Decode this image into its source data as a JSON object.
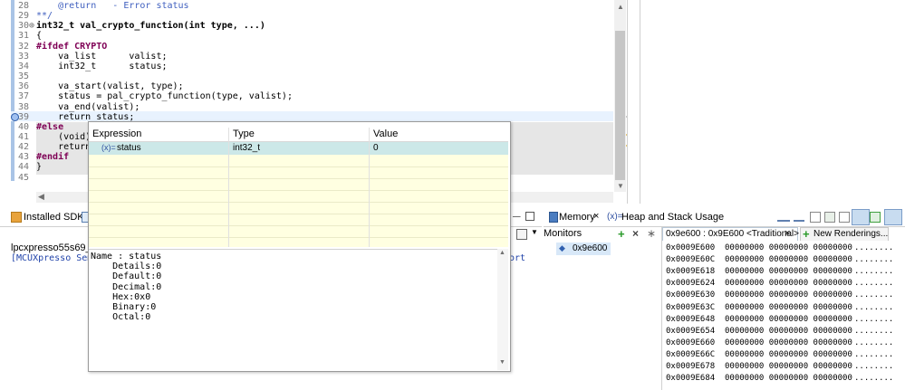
{
  "editor": {
    "lines": [
      {
        "n": "28",
        "text": "    @return   - Error status",
        "cls": "cm"
      },
      {
        "n": "29",
        "text": "**/",
        "cls": "cm"
      },
      {
        "n": "30⊕",
        "text": "int32_t val_crypto_function(int type, ...)",
        "cls": "fn"
      },
      {
        "n": "31",
        "text": "{",
        "cls": ""
      },
      {
        "n": "32",
        "text": "#ifdef CRYPTO",
        "cls": "pp"
      },
      {
        "n": "33",
        "text": "    va_list      valist;",
        "cls": ""
      },
      {
        "n": "34",
        "text": "    int32_t      status;",
        "cls": "st"
      },
      {
        "n": "35",
        "text": "",
        "cls": ""
      },
      {
        "n": "36",
        "text": "    va_start(valist, type);",
        "cls": ""
      },
      {
        "n": "37",
        "text": "    status = pal_crypto_function(type, valist);",
        "cls": ""
      },
      {
        "n": "38",
        "text": "    va_end(valist);",
        "cls": ""
      },
      {
        "n": "39",
        "text": "    return status;",
        "cls": ""
      },
      {
        "n": "40",
        "text": "#else",
        "cls": "pp"
      },
      {
        "n": "41",
        "text": "    (void)t",
        "cls": ""
      },
      {
        "n": "42",
        "text": "    return",
        "cls": ""
      },
      {
        "n": "43",
        "text": "#endif",
        "cls": "pp"
      },
      {
        "n": "44",
        "text": "}",
        "cls": ""
      },
      {
        "n": "45",
        "text": "",
        "cls": ""
      }
    ]
  },
  "bottom_left": {
    "tab_installed_sdks": "Installed SDKs",
    "console_title": "lpcxpresso55s69_tfm_p",
    "console_line_start": "[MCUXpresso Semi",
    "console_line_end": "ort"
  },
  "memory_view": {
    "tab_memory": "Memory",
    "tab_heap": "Heap and Stack Usage",
    "monitors_label": "Monitors",
    "monitor_item": "0x9e600",
    "rendering_tab": "0x9e600 : 0x9E600 <Traditional>",
    "new_renderings": "New Renderings...",
    "rows": [
      {
        "addr": "0x0009E600",
        "data": "00000000 00000000 00000000",
        "ascii": "........"
      },
      {
        "addr": "0x0009E60C",
        "data": "00000000 00000000 00000000",
        "ascii": "........"
      },
      {
        "addr": "0x0009E618",
        "data": "00000000 00000000 00000000",
        "ascii": "........"
      },
      {
        "addr": "0x0009E624",
        "data": "00000000 00000000 00000000",
        "ascii": "........"
      },
      {
        "addr": "0x0009E630",
        "data": "00000000 00000000 00000000",
        "ascii": "........"
      },
      {
        "addr": "0x0009E63C",
        "data": "00000000 00000000 00000000",
        "ascii": "........"
      },
      {
        "addr": "0x0009E648",
        "data": "00000000 00000000 00000000",
        "ascii": "........"
      },
      {
        "addr": "0x0009E654",
        "data": "00000000 00000000 00000000",
        "ascii": "........"
      },
      {
        "addr": "0x0009E660",
        "data": "00000000 00000000 00000000",
        "ascii": "........"
      },
      {
        "addr": "0x0009E66C",
        "data": "00000000 00000000 00000000",
        "ascii": "........"
      },
      {
        "addr": "0x0009E678",
        "data": "00000000 00000000 00000000",
        "ascii": "........"
      },
      {
        "addr": "0x0009E684",
        "data": "00000000 00000000 00000000",
        "ascii": "........"
      }
    ]
  },
  "popup": {
    "col_expression": "Expression",
    "col_type": "Type",
    "col_value": "Value",
    "row": {
      "icon": "(x)=",
      "name": "status",
      "type": "int32_t",
      "value": "0"
    },
    "details": [
      "Name : status",
      "    Details:0",
      "    Default:0",
      "    Decimal:0",
      "    Hex:0x0",
      "    Binary:0",
      "    Octal:0"
    ]
  },
  "icon_names": [
    "variable-icon",
    "sdk-icon",
    "memory-icon",
    "heap-icon",
    "add-monitor-icon",
    "remove-monitor-icon",
    "remove-all-icon",
    "close-icon",
    "maximize-icon",
    "minimize-icon",
    "view-menu-icon"
  ]
}
